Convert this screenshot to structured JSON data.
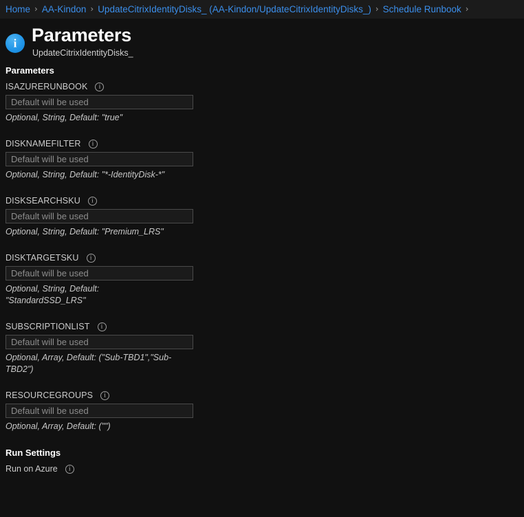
{
  "breadcrumb": {
    "separator": "›",
    "items": [
      {
        "label": "Home"
      },
      {
        "label": "AA-Kindon"
      },
      {
        "label": "UpdateCitrixIdentityDisks_ (AA-Kindon/UpdateCitrixIdentityDisks_)"
      },
      {
        "label": "Schedule Runbook"
      }
    ]
  },
  "header": {
    "icon": "info-circle-icon",
    "title": "Parameters",
    "subtitle": "UpdateCitrixIdentityDisks_",
    "accent_color": "#2196e8"
  },
  "main": {
    "section_label": "Parameters",
    "input_placeholder": "Default will be used",
    "info_icon": "info-circle-icon",
    "parameters": [
      {
        "name": "ISAZURERUNBOOK",
        "value": "",
        "placeholder": "Default will be used",
        "help": "Optional, String, Default: \"true\""
      },
      {
        "name": "DISKNAMEFILTER",
        "value": "",
        "placeholder": "Default will be used",
        "help": "Optional, String, Default: \"*-IdentityDisk-*\""
      },
      {
        "name": "DISKSEARCHSKU",
        "value": "",
        "placeholder": "Default will be used",
        "help": "Optional, String, Default: \"Premium_LRS\""
      },
      {
        "name": "DISKTARGETSKU",
        "value": "",
        "placeholder": "Default will be used",
        "help": "Optional, String, Default: \"StandardSSD_LRS\""
      },
      {
        "name": "SUBSCRIPTIONLIST",
        "value": "",
        "placeholder": "Default will be used",
        "help": "Optional, Array, Default: (\"Sub-TBD1\",\"Sub-TBD2\")"
      },
      {
        "name": "RESOURCEGROUPS",
        "value": "",
        "placeholder": "Default will be used",
        "help": "Optional, Array, Default: (\"\")"
      }
    ]
  },
  "run_settings": {
    "title": "Run Settings",
    "run_on_label": "Run on Azure",
    "info_icon": "info-circle-icon"
  },
  "colors": {
    "background": "#111111",
    "breadcrumb_background": "#1b1b1b",
    "link": "#3b8eea",
    "label": "#cccccc",
    "input_border": "#4a4a4a"
  }
}
